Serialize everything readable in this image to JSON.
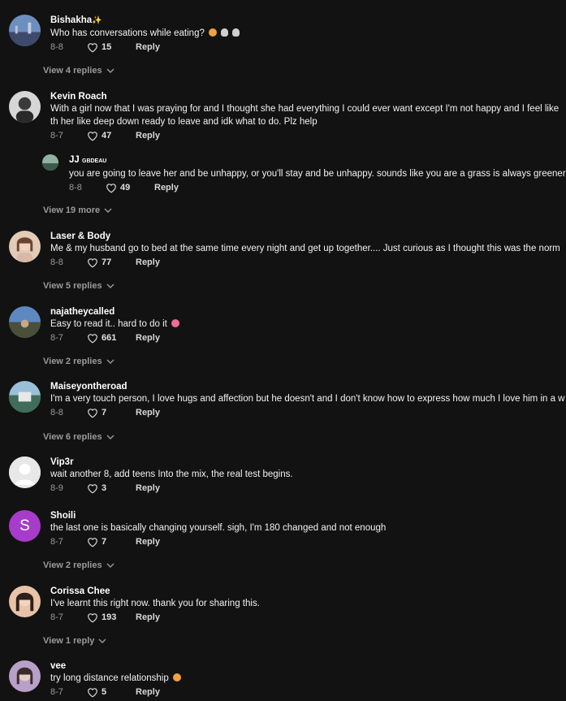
{
  "comments": [
    {
      "user": "Bishakha",
      "suffix": "✨",
      "text": "Who has conversations while eating?",
      "date": "8-8",
      "likes": "15",
      "reply": "Reply",
      "more": "View 4 replies"
    },
    {
      "user": "Kevin Roach",
      "text": "With a girl now that I was praying for and I thought she had everything I could ever want except I'm not happy and I feel like",
      "text2": "th her like deep down ready to leave and idk what to do. Plz help",
      "date": "8-7",
      "likes": "47",
      "reply": "Reply"
    },
    {
      "user": "JJ",
      "tag": "GBDEAU",
      "text": "you are going to leave her and be unhappy, or you'll stay and be unhappy. sounds like you are a grass is always greener",
      "date": "8-8",
      "likes": "49",
      "reply": "Reply",
      "more": "View 19 more"
    },
    {
      "user": "Laser & Body",
      "text": "Me & my husband go to bed at the same time every night and get up together.... Just curious as I thought this was the norm",
      "date": "8-8",
      "likes": "77",
      "reply": "Reply",
      "more": "View 5 replies"
    },
    {
      "user": "najatheycalled",
      "text": "Easy to read it.. hard to do it",
      "date": "8-7",
      "likes": "661",
      "reply": "Reply",
      "more": "View 2 replies"
    },
    {
      "user": "Maiseyontheroad",
      "text": "I'm a very touch person, I love hugs and affection but he doesn't and I don't know how to express how much I love him in a w",
      "date": "8-8",
      "likes": "7",
      "reply": "Reply",
      "more": "View 6 replies"
    },
    {
      "user": "Vip3r",
      "text": "wait another 8, add teens Into the mix, the real test begins.",
      "date": "8-9",
      "likes": "3",
      "reply": "Reply"
    },
    {
      "user": "Shoili",
      "initial": "S",
      "text": "the last one is basically changing yourself. sigh, I'm 180 changed and not enough",
      "date": "8-7",
      "likes": "7",
      "reply": "Reply",
      "more": "View 2 replies"
    },
    {
      "user": "Corissa Chee",
      "text": "I've learnt this right now. thank you for sharing this.",
      "date": "8-7",
      "likes": "193",
      "reply": "Reply",
      "more": "View 1 reply"
    },
    {
      "user": "vee",
      "text": "try long distance relationship",
      "date": "8-7",
      "likes": "5",
      "reply": "Reply"
    }
  ],
  "colors": {
    "background": "#121212",
    "muted": "#9a9a9a",
    "initial_avatar": "#a63cc9"
  }
}
